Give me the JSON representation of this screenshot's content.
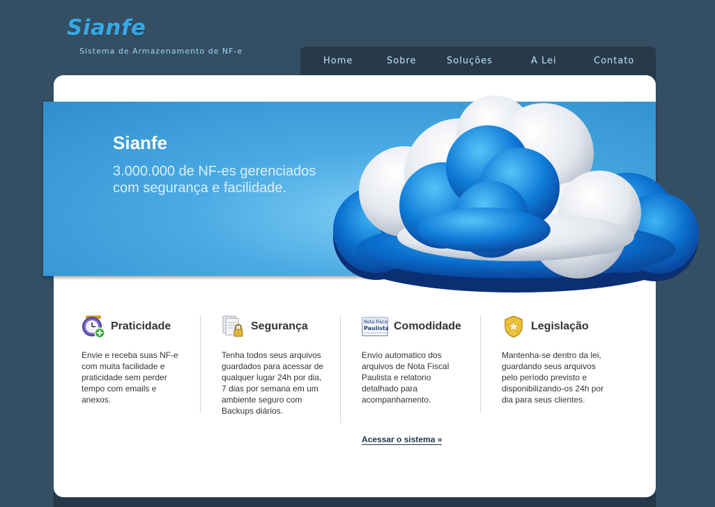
{
  "header": {
    "logo": "Sianfe",
    "tagline": "Sistema de Armazenamento de NF-e"
  },
  "nav": [
    {
      "label": "Home"
    },
    {
      "label": "Sobre"
    },
    {
      "label": "Soluções"
    },
    {
      "label": "A Lei"
    },
    {
      "label": "Contato"
    }
  ],
  "banner": {
    "title": "Sianfe",
    "line1": "3.000.000 de NF-es gerenciados",
    "line2": "com segurança e facilidade.",
    "image": "cloud-illustration"
  },
  "features": [
    {
      "icon": "clock-add-icon",
      "title": "Praticidade",
      "text": "Envie e receba suas NF-e\ncom muita facilidade e\npraticidade sem perder\ntempo com emails e\nanexos."
    },
    {
      "icon": "lock-documents-icon",
      "title": "Segurança",
      "text": "Tenha todos seus arquivos\nguardados para acessar de\nqualquer lugar 24h por dia,\n7 dias por semana em um\nambiente seguro com\nBackups diários."
    },
    {
      "icon": "nota-fiscal-paulista-logo",
      "title": "Comodidade",
      "text": "Envio automatico dos\narquivos de Nota Fiscal\nPaulista e relatorio\ndetalhado para\nacompanhamento.",
      "logo_text": [
        "Nota Fiscal",
        "Paulista"
      ]
    },
    {
      "icon": "gold-badge-icon",
      "title": "Legislação",
      "text": "Mantenha-se dentro da lei,\nguardando seus arquivos\npelo período previsto e\ndisponibilizando-os 24h por\ndia para seus clientes."
    }
  ],
  "access_link": "Acessar o sistema »",
  "colors": {
    "background": "#344e63",
    "accent": "#36a9e6",
    "nav_bg": "#28394a",
    "banner": "#3d9ed9"
  }
}
